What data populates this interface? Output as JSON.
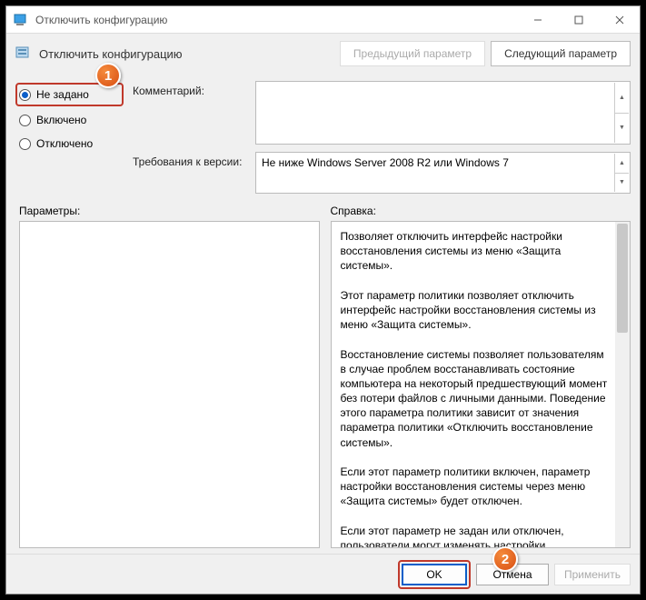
{
  "window": {
    "title": "Отключить конфигурацию"
  },
  "header": {
    "policy_title": "Отключить конфигурацию",
    "prev": "Предыдущий параметр",
    "next": "Следующий параметр"
  },
  "radios": {
    "not_configured": "Не задано",
    "enabled": "Включено",
    "disabled": "Отключено"
  },
  "labels": {
    "comment": "Комментарий:",
    "requirements": "Требования к версии:",
    "options": "Параметры:",
    "help": "Справка:"
  },
  "requirements_text": "Не ниже Windows Server 2008 R2 или Windows 7",
  "help_text": "Позволяет отключить интерфейс настройки восстановления системы из меню «Защита системы».\n\nЭтот параметр политики позволяет отключить интерфейс настройки восстановления системы из меню «Защита системы».\n\nВосстановление системы позволяет пользователям в случае проблем восстанавливать состояние компьютера на некоторый предшествующий момент без потери файлов с личными данными. Поведение этого параметра политики зависит от значения параметра политики «Отключить восстановление системы».\n\nЕсли этот параметр политики включен, параметр настройки восстановления системы через меню «Защита системы» будет отключен.\n\nЕсли этот параметр не задан или отключен, пользователи могут изменять настройки восстановления системы в меню «Защита системы».",
  "buttons": {
    "ok": "OK",
    "cancel": "Отмена",
    "apply": "Применить"
  },
  "badges": {
    "one": "1",
    "two": "2"
  }
}
